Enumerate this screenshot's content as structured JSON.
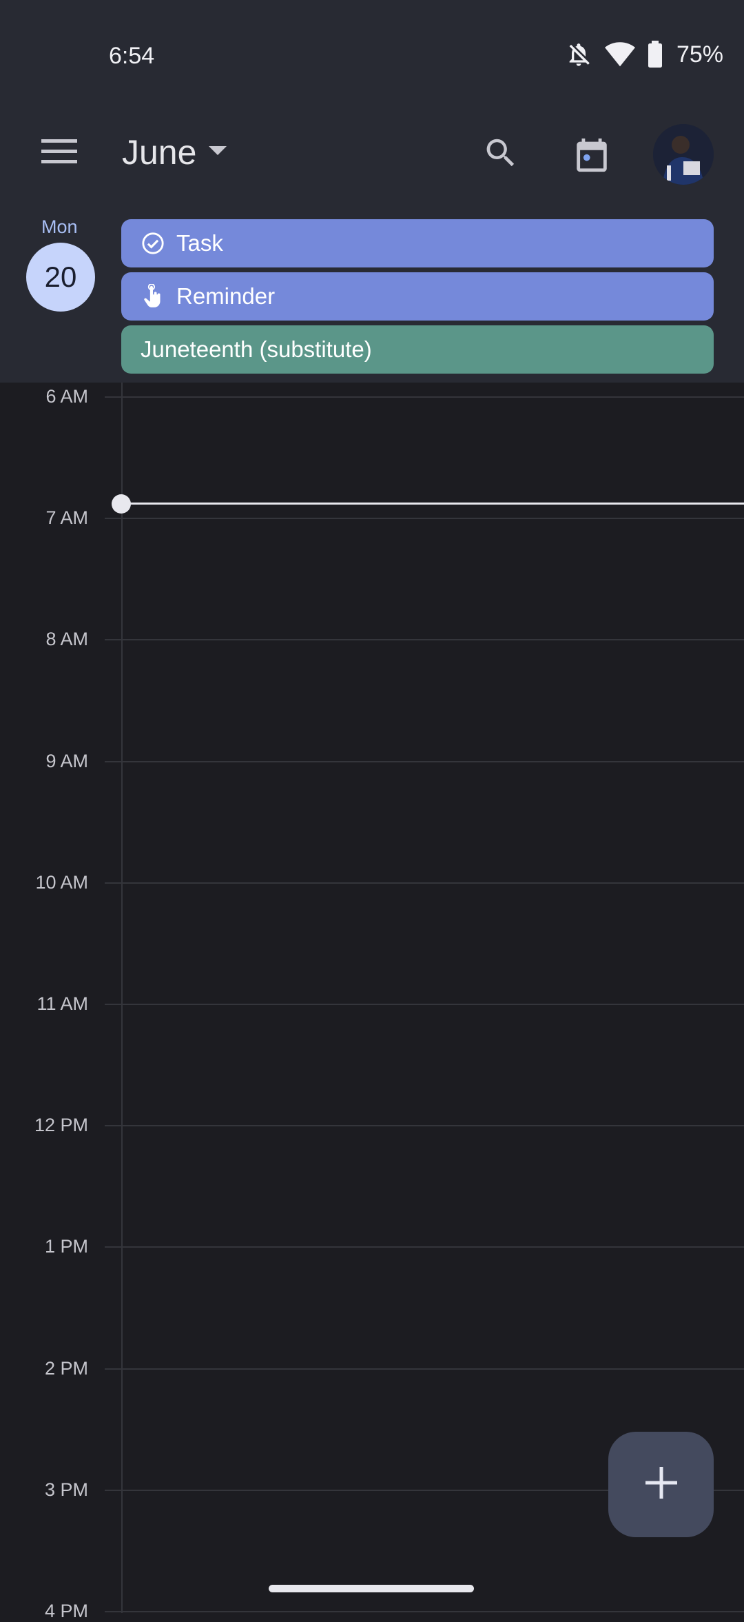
{
  "status_bar": {
    "time": "6:54",
    "battery_percent": "75%",
    "icons": [
      "bell-off-icon",
      "wifi-icon",
      "battery-icon"
    ]
  },
  "header": {
    "month": "June",
    "icons": [
      "menu-icon",
      "dropdown-icon",
      "search-icon",
      "today-calendar-icon",
      "avatar"
    ]
  },
  "day": {
    "weekday": "Mon",
    "date": "20"
  },
  "all_day_events": [
    {
      "label": "Task",
      "icon": "task-check-icon",
      "color": "#7589da"
    },
    {
      "label": "Reminder",
      "icon": "reminder-hand-icon",
      "color": "#7589da"
    },
    {
      "label": "Juneteenth (substitute)",
      "icon": "",
      "color": "#5b9689"
    }
  ],
  "hours": [
    "6 AM",
    "7 AM",
    "8 AM",
    "9 AM",
    "10 AM",
    "11 AM",
    "12 PM",
    "1 PM",
    "2 PM",
    "3 PM",
    "4 PM"
  ],
  "fab": {
    "icon": "add-icon"
  },
  "colors": {
    "accent": "#c6d4fb",
    "background": "#1c1c21",
    "header_bg": "#282a33",
    "current_time_line": "#e8e8ee"
  }
}
